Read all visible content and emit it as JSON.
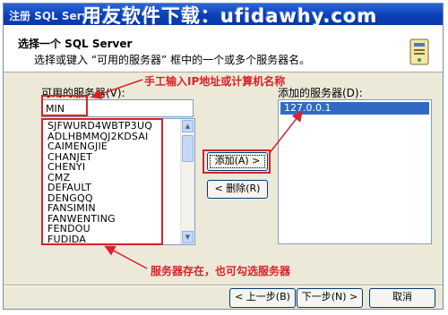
{
  "window": {
    "title": "注册 SQL Server",
    "watermark": "用友软件下载：ufidawhy.com"
  },
  "header": {
    "title": "选择一个 SQL Server",
    "subtitle": "选择或键入 “可用的服务器” 框中的一个或多个服务器名。"
  },
  "available": {
    "label": "可用的服务器(V):",
    "input_value": "MIN",
    "items": [
      "SJFWURD4WBTP3UQ",
      "ADLHBMMQJ2KDSAI",
      "CAIMENGJIE",
      "CHANJET",
      "CHENYI",
      "CMZ",
      "DEFAULT",
      "DENGQQ",
      "FANSIMIN",
      "FANWENTING",
      "FENDOU",
      "FUDIDA"
    ]
  },
  "added": {
    "label": "添加的服务器(D):",
    "items": [
      "127.0.0.1"
    ]
  },
  "buttons": {
    "add": "添加(A) >",
    "remove": "< 删除(R)",
    "back": "< 上一步(B)",
    "next": "下一步(N) >",
    "cancel": "取消"
  },
  "annotations": {
    "manual_input": "手工输入IP地址或计算机名称",
    "server_exists": "服务器存在，也可勾选服务器"
  },
  "colors": {
    "annotation_red": "#d8222a",
    "title_blue": "#0a3fb8",
    "selection_blue": "#316ac5"
  }
}
